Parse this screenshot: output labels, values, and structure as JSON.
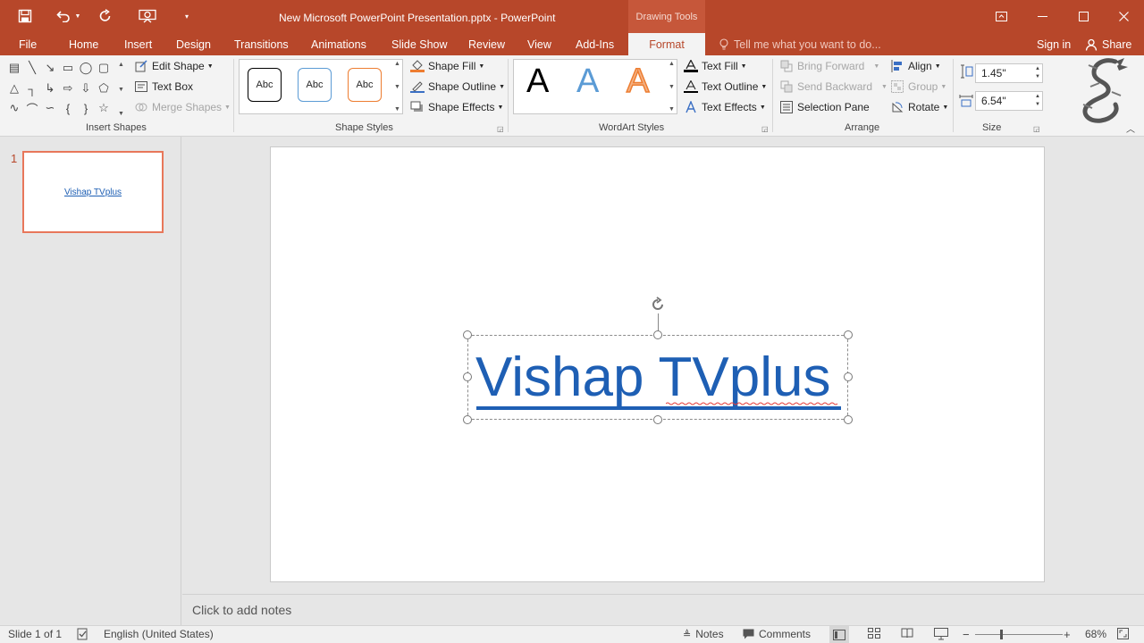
{
  "titlebar": {
    "doc_title": "New Microsoft PowerPoint Presentation.pptx - PowerPoint",
    "context_label": "Drawing Tools",
    "accent": "#b7472a"
  },
  "tabs": {
    "file": "File",
    "home": "Home",
    "insert": "Insert",
    "design": "Design",
    "transitions": "Transitions",
    "animations": "Animations",
    "slideshow": "Slide Show",
    "review": "Review",
    "view": "View",
    "addins": "Add-Ins",
    "format": "Format",
    "tell_me": "Tell me what you want to do...",
    "sign_in": "Sign in",
    "share": "Share"
  },
  "ribbon": {
    "insert_shapes": {
      "label": "Insert Shapes",
      "edit_shape": "Edit Shape",
      "text_box": "Text Box",
      "merge_shapes": "Merge Shapes"
    },
    "shape_styles": {
      "label": "Shape Styles",
      "sample": "Abc",
      "shape_fill": "Shape Fill",
      "shape_outline": "Shape Outline",
      "shape_effects": "Shape Effects"
    },
    "wordart": {
      "label": "WordArt Styles",
      "sample": "A",
      "text_fill": "Text Fill",
      "text_outline": "Text Outline",
      "text_effects": "Text Effects"
    },
    "arrange": {
      "label": "Arrange",
      "bring_forward": "Bring Forward",
      "send_backward": "Send Backward",
      "selection_pane": "Selection Pane",
      "align": "Align",
      "group": "Group",
      "rotate": "Rotate"
    },
    "size": {
      "label": "Size",
      "height": "1.45\"",
      "width": "6.54\""
    }
  },
  "thumbnails": [
    {
      "number": "1",
      "text": "Vishap TVplus"
    }
  ],
  "slide": {
    "text": "Vishap TVplus",
    "text_color": "#1e5fb4"
  },
  "notes": {
    "placeholder": "Click to add notes"
  },
  "status": {
    "slide_info": "Slide 1 of 1",
    "language": "English (United States)",
    "notes": "Notes",
    "comments": "Comments",
    "zoom": "68%"
  }
}
